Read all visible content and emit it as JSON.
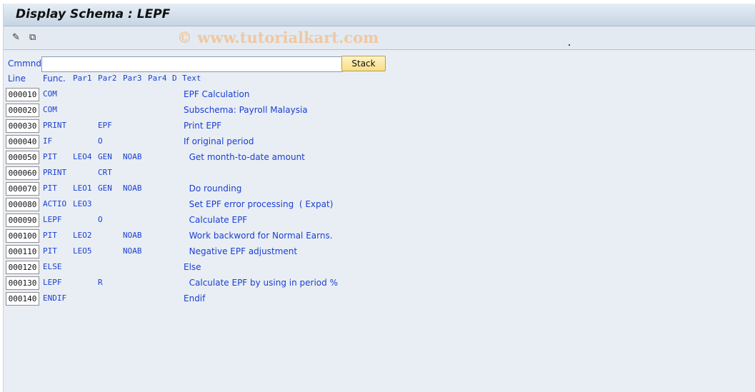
{
  "title": "Display Schema : LEPF",
  "watermark": "© www.tutorialkart.com",
  "toolbar": {
    "icons": [
      "edit-pencil-icon",
      "hierarchy-icon"
    ]
  },
  "command": {
    "label": "Cmmnd",
    "value": "",
    "button": "Stack"
  },
  "headers": {
    "line": "Line",
    "func": "Func.",
    "par1": "Par1",
    "par2": "Par2",
    "par3": "Par3",
    "par4": "Par4",
    "d": "D",
    "text": "Text"
  },
  "rows": [
    {
      "line": "000010",
      "func": "COM",
      "par1": "",
      "par2": "",
      "par3": "",
      "text": "EPF Calculation"
    },
    {
      "line": "000020",
      "func": "COM",
      "par1": "",
      "par2": "",
      "par3": "",
      "text": "Subschema: Payroll Malaysia"
    },
    {
      "line": "000030",
      "func": "PRINT",
      "par1": "",
      "par2": "EPF",
      "par3": "",
      "text": "Print EPF"
    },
    {
      "line": "000040",
      "func": "IF",
      "par1": "",
      "par2": "O",
      "par3": "",
      "text": "If original period"
    },
    {
      "line": "000050",
      "func": "PIT",
      "par1": "LEO4",
      "par2": "GEN",
      "par3": "NOAB",
      "text": "  Get month-to-date amount"
    },
    {
      "line": "000060",
      "func": "PRINT",
      "par1": "",
      "par2": "CRT",
      "par3": "",
      "text": ""
    },
    {
      "line": "000070",
      "func": "PIT",
      "par1": "LEO1",
      "par2": "GEN",
      "par3": "NOAB",
      "text": "  Do rounding"
    },
    {
      "line": "000080",
      "func": "ACTIO",
      "par1": "LEO3",
      "par2": "",
      "par3": "",
      "text": "  Set EPF error processing  ( Expat)"
    },
    {
      "line": "000090",
      "func": "LEPF",
      "par1": "",
      "par2": "O",
      "par3": "",
      "text": "  Calculate EPF"
    },
    {
      "line": "000100",
      "func": "PIT",
      "par1": "LEO2",
      "par2": "",
      "par3": "NOAB",
      "text": "  Work backword for Normal Earns."
    },
    {
      "line": "000110",
      "func": "PIT",
      "par1": "LEO5",
      "par2": "",
      "par3": "NOAB",
      "text": "  Negative EPF adjustment"
    },
    {
      "line": "000120",
      "func": "ELSE",
      "par1": "",
      "par2": "",
      "par3": "",
      "text": "Else"
    },
    {
      "line": "000130",
      "func": "LEPF",
      "par1": "",
      "par2": "R",
      "par3": "",
      "text": "  Calculate EPF by using in period %"
    },
    {
      "line": "000140",
      "func": "ENDIF",
      "par1": "",
      "par2": "",
      "par3": "",
      "text": "Endif"
    }
  ]
}
